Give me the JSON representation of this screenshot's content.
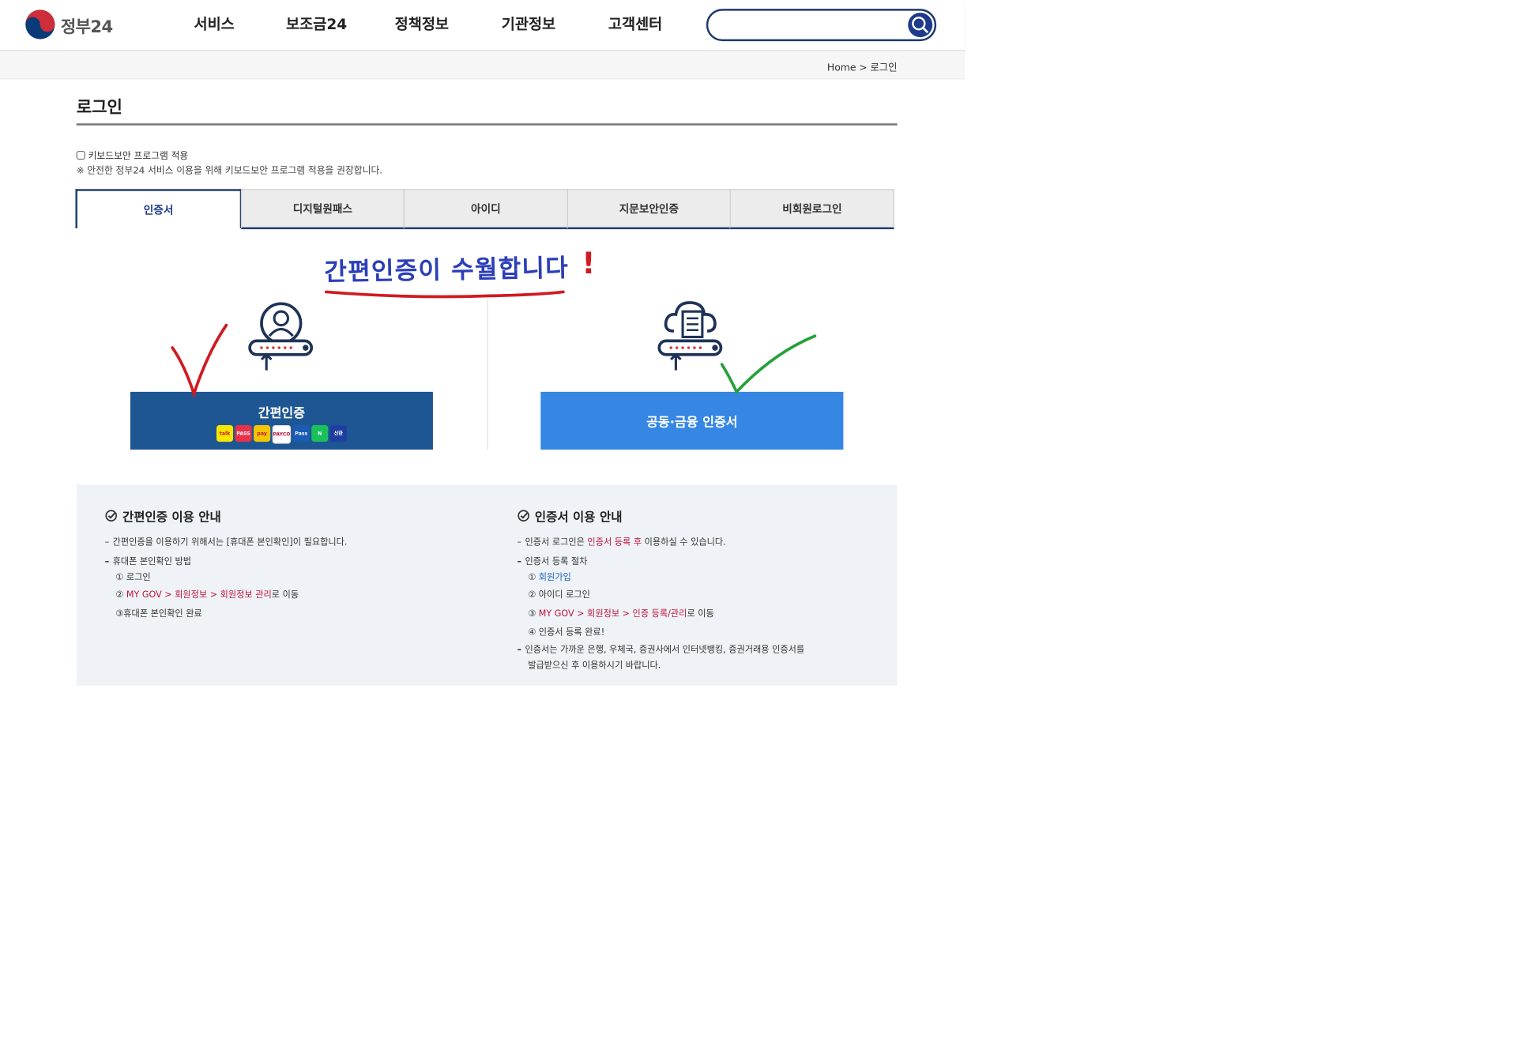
{
  "header": {
    "logo_text": "정부24",
    "nav": [
      "서비스",
      "보조금24",
      "정책정보",
      "기관정보",
      "고객센터"
    ],
    "search_placeholder": ""
  },
  "breadcrumb": {
    "home": "Home",
    "sep": ">",
    "current": "로그인"
  },
  "page_title": "로그인",
  "keyboard_security": {
    "label": "키보드보안 프로그램 적용",
    "note": "※ 안전한 정부24 서비스 이용을 위해 키보드보안 프로그램 적용을 권장합니다."
  },
  "tabs": [
    "인증서",
    "디지털원패스",
    "아이디",
    "지문보안인증",
    "비회원로그인"
  ],
  "options": {
    "simple_label": "간편인증",
    "cert_label": "공동·금융 인증서",
    "badges": [
      {
        "icon": "kakao-icon",
        "text": "talk",
        "color": "#f7e600"
      },
      {
        "icon": "pass-icon",
        "text": "PASS",
        "color": "#e8324a"
      },
      {
        "icon": "payco-icon",
        "text": "pay",
        "color": "#f3c400"
      },
      {
        "icon": "samsung-pass-icon",
        "text": "PAYCO",
        "color": "#ffffff"
      },
      {
        "icon": "kb-icon",
        "text": "Pass",
        "color": "#1a5bb4"
      },
      {
        "icon": "naver-icon",
        "text": "N",
        "color": "#19c05b"
      },
      {
        "icon": "shinhan-icon",
        "text": "신한",
        "color": "#1f3fa0"
      }
    ]
  },
  "annotation": {
    "text": "간편인증이 수월합니다",
    "mark": "!"
  },
  "guide": {
    "left_title": "간편인증 이용 안내",
    "left_lines": {
      "l1": "간편인증을 이용하기 위해서는 [휴대폰 본인확인]이 필요합니다.",
      "l2": "휴대폰 본인확인 방법",
      "l3": "① 로그인",
      "l4_a": "② ",
      "l4_b": "MY GOV > 회원정보 > 회원정보 관리",
      "l4_c": "로 이동",
      "l5": "③휴대폰 본인확인 완료"
    },
    "right_title": "인증서 이용 안내",
    "right_lines": {
      "r1_a": "인증서 로그인은 ",
      "r1_b": "인증서 등록 후",
      "r1_c": " 이용하실 수 있습니다.",
      "r2": "인증서 등록 절차",
      "r3_a": "① ",
      "r3_b": "회원가입",
      "r4": "② 아이디 로그인",
      "r5_a": "③ ",
      "r5_b": "MY GOV > 회원정보 > 인증 등록/관리",
      "r5_c": "로 이동",
      "r6": "④ 인증서 등록 완료!",
      "r7": "인증서는 가까운 은행, 우체국, 증권사에서 인터넷뱅킹, 증권거래용 인증서를",
      "r8": "발급받으신 후 이용하시기 바랍니다."
    }
  },
  "colors": {
    "navy": "#1d5692",
    "cert_blue": "#3686e3",
    "annotation_blue": "#2c3fb8",
    "annotation_red": "#d01a22",
    "annotation_green": "#25a13a"
  }
}
